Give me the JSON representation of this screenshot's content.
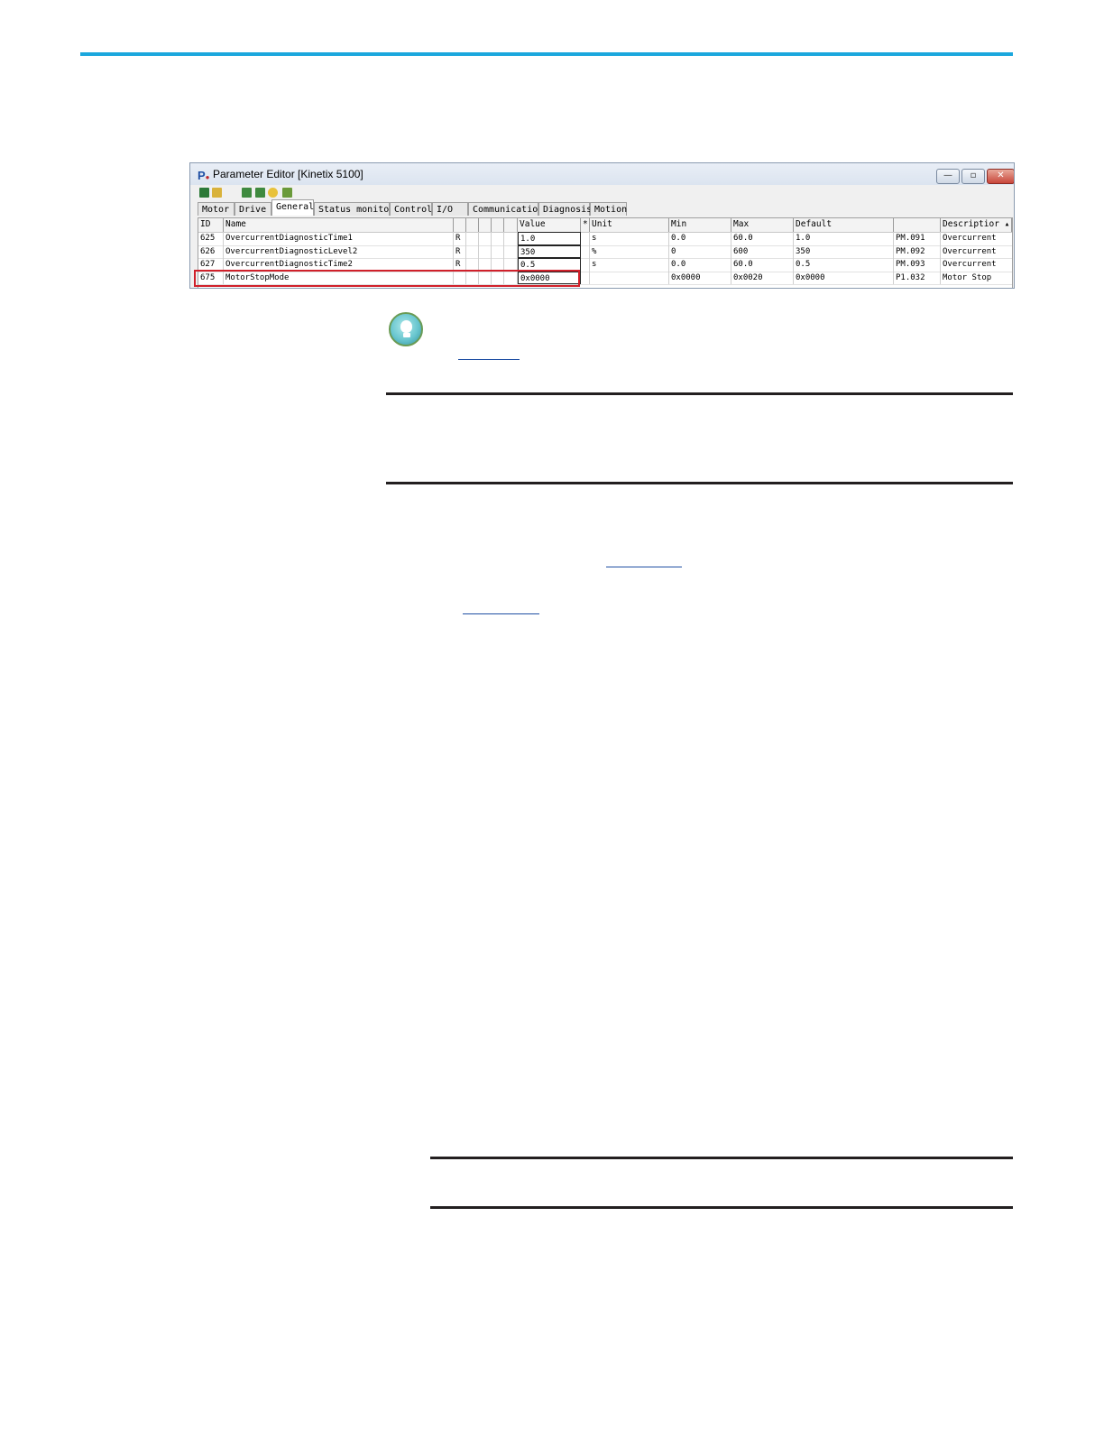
{
  "window": {
    "title": "Parameter Editor [Kinetix 5100]",
    "app_icon": "P",
    "controls": {
      "minimize": "—",
      "maximize": "▫",
      "close": "✕"
    }
  },
  "toolbar": {
    "icons": [
      "save-icon",
      "open-folder-icon",
      "upload-icon",
      "download-icon",
      "reset-icon",
      "compare-icon"
    ]
  },
  "tabs": [
    {
      "label": "Motor",
      "active": false
    },
    {
      "label": "Drive",
      "active": false
    },
    {
      "label": "General",
      "active": true
    },
    {
      "label": "Status monitor",
      "active": false
    },
    {
      "label": "Control",
      "active": false
    },
    {
      "label": "I/O",
      "active": false
    },
    {
      "label": "Communication",
      "active": false
    },
    {
      "label": "Diagnosis",
      "active": false
    },
    {
      "label": "Motion",
      "active": false
    }
  ],
  "table": {
    "headers": {
      "id": "ID",
      "name": "Name",
      "value": "Value",
      "star": "*",
      "unit": "Unit",
      "min": "Min",
      "max": "Max",
      "default": "Default",
      "code": "",
      "description": "Descriptior ▴"
    },
    "rows": [
      {
        "id": "625",
        "name": "OvercurrentDiagnosticTime1",
        "r": "R",
        "value": "1.0",
        "unit": "s",
        "min": "0.0",
        "max": "60.0",
        "default": "1.0",
        "code": "PM.091",
        "description": "Overcurrent"
      },
      {
        "id": "626",
        "name": "OvercurrentDiagnosticLevel2",
        "r": "R",
        "value": "350",
        "unit": "%",
        "min": "0",
        "max": "600",
        "default": "350",
        "code": "PM.092",
        "description": "Overcurrent"
      },
      {
        "id": "627",
        "name": "OvercurrentDiagnosticTime2",
        "r": "R",
        "value": "0.5",
        "unit": "s",
        "min": "0.0",
        "max": "60.0",
        "default": "0.5",
        "code": "PM.093",
        "description": "Overcurrent"
      },
      {
        "id": "675",
        "name": "MotorStopMode",
        "r": "",
        "value": "0x0000",
        "unit": "",
        "min": "0x0000",
        "max": "0x0020",
        "default": "0x0000",
        "code": "P1.032",
        "description": "Motor Stop"
      }
    ],
    "highlighted_row": "675"
  },
  "colors": {
    "accent_rule": "#1ba7dd",
    "highlight": "#d0202a",
    "link": "#1f4fa3",
    "tip_icon": "#69c6cf"
  }
}
